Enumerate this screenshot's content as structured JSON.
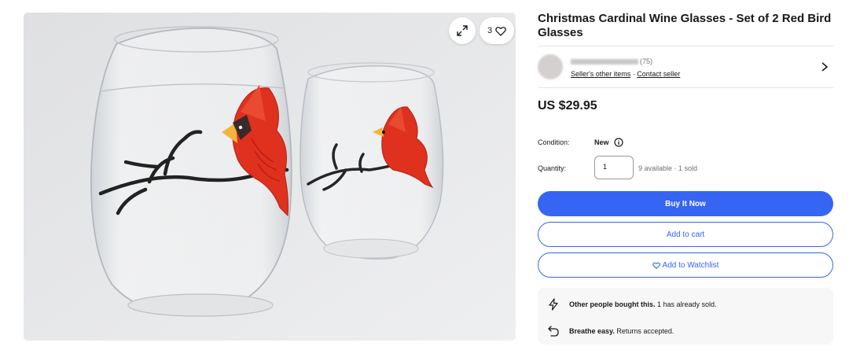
{
  "listing": {
    "title": "Christmas Cardinal Wine Glasses - Set of 2 Red Bird Glasses",
    "watch_count": "3",
    "price": "US $29.95"
  },
  "seller": {
    "feedback": "(75)",
    "other_items_link": "Seller's other items",
    "separator": " · ",
    "contact_link": "Contact seller"
  },
  "details": {
    "condition_label": "Condition:",
    "condition_value": "New",
    "quantity_label": "Quantity:",
    "quantity_value": "1",
    "availability": "9 available · 1 sold"
  },
  "actions": {
    "buy_now": "Buy It Now",
    "add_to_cart": "Add to cart",
    "add_to_watchlist": "Add to Watchlist"
  },
  "info": {
    "bought_bold": "Other people bought this.",
    "bought_rest": " 1 has already sold.",
    "returns_bold": "Breathe easy.",
    "returns_rest": " Returns accepted."
  },
  "colors": {
    "primary_blue": "#3665f3",
    "text": "#191919",
    "muted": "#707070",
    "cardinal_red": "#e0301e"
  },
  "icons": [
    "expand-icon",
    "heart-icon",
    "chevron-right-icon",
    "info-icon",
    "lightning-icon",
    "return-arrow-icon"
  ]
}
